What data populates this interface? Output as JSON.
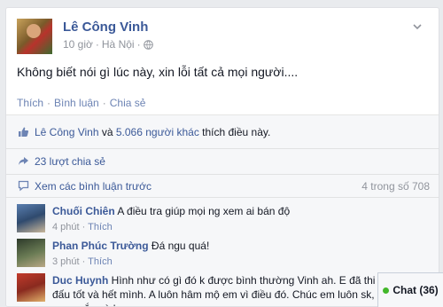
{
  "post": {
    "author": "Lê Công Vinh",
    "time": "10 giờ",
    "separator": "·",
    "location": "Hà Nội",
    "separator2": "·",
    "text": "Không biết nói gì lúc này, xin lỗi tất cả mọi người....",
    "actions": {
      "like": "Thích",
      "comment": "Bình luận",
      "share": "Chia sẻ",
      "dot": "·"
    }
  },
  "ufi": {
    "likes": {
      "name": "Lê Công Vinh",
      "and": " và ",
      "others": "5.066 người khác",
      "suffix": " thích điều này."
    },
    "shares": "23 lượt chia sẻ",
    "view_previous": "Xem các bình luận trước",
    "count": "4 trong số 708"
  },
  "comments": [
    {
      "name": "Chuối Chiên",
      "text": " A điều tra giúp mọi ng xem ai bán độ",
      "time": "4 phút",
      "action": "Thích",
      "dot": " · "
    },
    {
      "name": "Phan Phúc Trường",
      "text": " Đá ngu quá!",
      "time": "3 phút",
      "action": "Thích",
      "dot": " · "
    },
    {
      "name": "Duc Huynh",
      "text": " Hình như có gì đó k được bình thường Vinh ah. E đã thi đấu tốt và hết mình. A luôn hâm mộ em vì điều đó. Chúc em luôn sk, may mắn và hp.",
      "time": "",
      "action": "",
      "dot": ""
    }
  ],
  "chat": {
    "label": "Chat (36)"
  },
  "colors": {
    "link": "#3b5998",
    "muted": "#90949c",
    "online": "#42b72a"
  },
  "icons": {
    "globe": "globe-icon",
    "chevron": "chevron-down-icon",
    "like": "thumbs-up-icon",
    "share": "share-icon",
    "comment": "comment-icon"
  }
}
